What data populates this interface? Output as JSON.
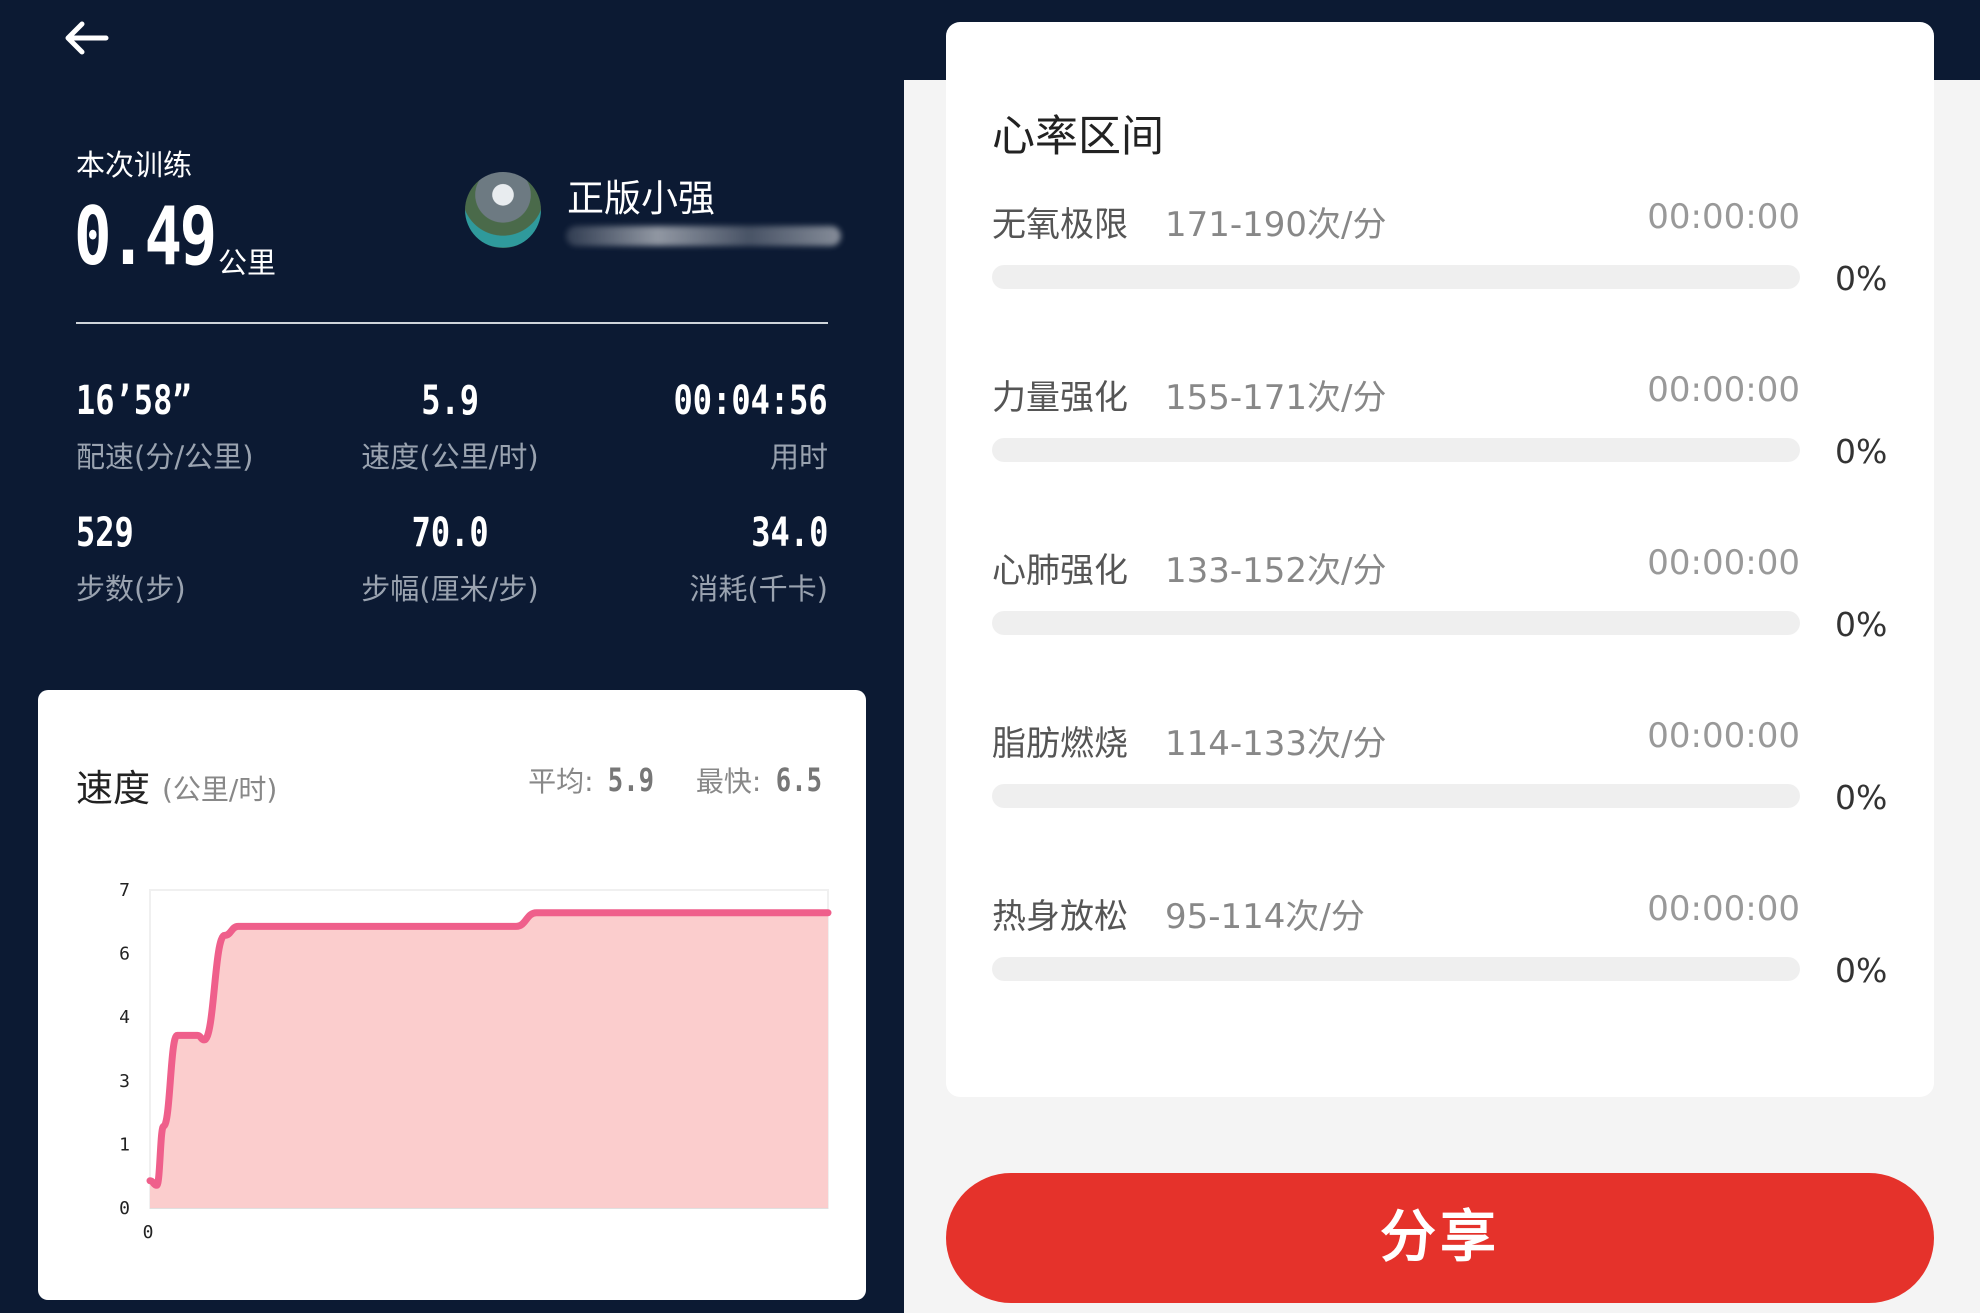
{
  "training": {
    "label": "本次训练",
    "distance": "0.49",
    "distance_unit": "公里"
  },
  "user": {
    "name": "正版小强"
  },
  "stats": [
    {
      "value": "16’58”",
      "label": "配速(分/公里)"
    },
    {
      "value": "5.9",
      "label": "速度(公里/时)"
    },
    {
      "value": "00:04:56",
      "label": "用时"
    },
    {
      "value": "529",
      "label": "步数(步)"
    },
    {
      "value": "70.0",
      "label": "步幅(厘米/步)"
    },
    {
      "value": "34.0",
      "label": "消耗(千卡)"
    }
  ],
  "speed_card": {
    "title": "速度",
    "unit": "(公里/时)",
    "avg_label": "平均:",
    "avg_value": "5.9",
    "max_label": "最快:",
    "max_value": "6.5"
  },
  "chart_data": {
    "type": "area",
    "title": "速度",
    "ylabel": "(公里/时)",
    "y_tick_labels": [
      "0",
      "1",
      "3",
      "4",
      "6",
      "7"
    ],
    "x_tick_labels": [
      "0"
    ],
    "ylim": [
      0,
      7
    ],
    "series": [
      {
        "x": [
          0,
          0.01,
          0.02,
          0.04,
          0.07,
          0.08,
          0.11,
          0.13,
          0.16,
          0.18,
          0.2,
          0.5,
          0.54,
          0.57,
          1.0
        ],
        "values": [
          0.6,
          0.5,
          1.8,
          3.8,
          3.8,
          3.7,
          6.0,
          6.2,
          6.2,
          6.2,
          6.2,
          6.2,
          6.2,
          6.5,
          6.5
        ]
      }
    ],
    "colors": {
      "line": "#ef5f8b",
      "fill": "#fbcaca"
    }
  },
  "heart_rate": {
    "title": "心率区间",
    "zones": [
      {
        "name": "无氧极限",
        "range": "171-190次/分",
        "time": "00:00:00",
        "percent": "0%",
        "fraction": 0
      },
      {
        "name": "力量强化",
        "range": "155-171次/分",
        "time": "00:00:00",
        "percent": "0%",
        "fraction": 0
      },
      {
        "name": "心肺强化",
        "range": "133-152次/分",
        "time": "00:00:00",
        "percent": "0%",
        "fraction": 0
      },
      {
        "name": "脂肪燃烧",
        "range": "114-133次/分",
        "time": "00:00:00",
        "percent": "0%",
        "fraction": 0
      },
      {
        "name": "热身放松",
        "range": "95-114次/分",
        "time": "00:00:00",
        "percent": "0%",
        "fraction": 0
      }
    ]
  },
  "share_button": {
    "label": "分享"
  },
  "icons": {
    "back": "back-arrow-icon"
  },
  "colors": {
    "dark_bg": "#0c1a33",
    "accent": "#e5322b",
    "chart_line": "#ef5f8b"
  }
}
